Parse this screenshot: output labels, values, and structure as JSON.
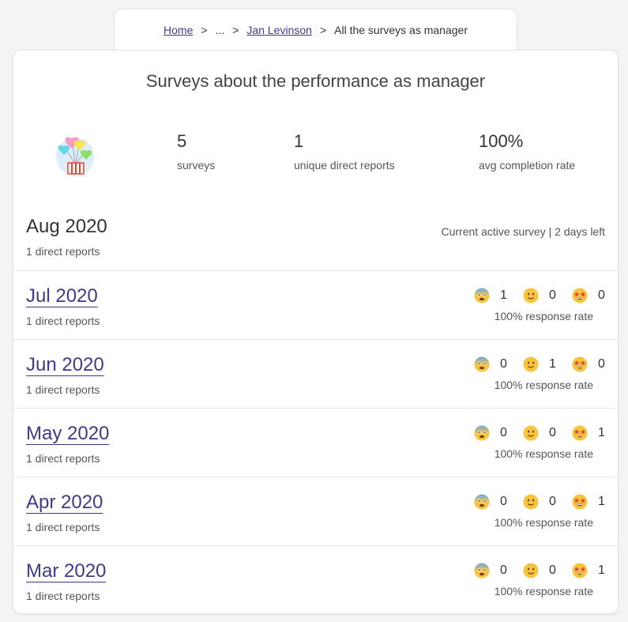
{
  "breadcrumb": {
    "home": "Home",
    "ellipsis": "...",
    "person": "Jan Levinson",
    "current": "All the surveys as manager",
    "separator": ">"
  },
  "title": "Surveys about the performance as manager",
  "stats": [
    {
      "value": "5",
      "label": "surveys"
    },
    {
      "value": "1",
      "label": "unique direct reports"
    },
    {
      "value": "100%",
      "label": "avg completion rate"
    }
  ],
  "active_row": {
    "month": "Aug 2020",
    "sub": "1 direct reports",
    "status": "Current active survey | 2 days left"
  },
  "rows": [
    {
      "month": "Jul 2020",
      "sub": "1 direct reports",
      "bad": "1",
      "neutral": "0",
      "great": "0",
      "rate": "100% response rate"
    },
    {
      "month": "Jun 2020",
      "sub": "1 direct reports",
      "bad": "0",
      "neutral": "1",
      "great": "0",
      "rate": "100% response rate"
    },
    {
      "month": "May 2020",
      "sub": "1 direct reports",
      "bad": "0",
      "neutral": "0",
      "great": "1",
      "rate": "100% response rate"
    },
    {
      "month": "Apr 2020",
      "sub": "1 direct reports",
      "bad": "0",
      "neutral": "0",
      "great": "1",
      "rate": "100% response rate"
    },
    {
      "month": "Mar 2020",
      "sub": "1 direct reports",
      "bad": "0",
      "neutral": "0",
      "great": "1",
      "rate": "100% response rate"
    }
  ],
  "icons": {
    "logo": "balloons-gift-icon",
    "bad": "fearful-face-icon",
    "neutral": "slightly-smiling-face-icon",
    "great": "star-struck-face-icon"
  },
  "colors": {
    "link": "#3f3a8e",
    "emoji_yellow": "#f8c33d",
    "bad_blue": "#6aa8e8"
  }
}
